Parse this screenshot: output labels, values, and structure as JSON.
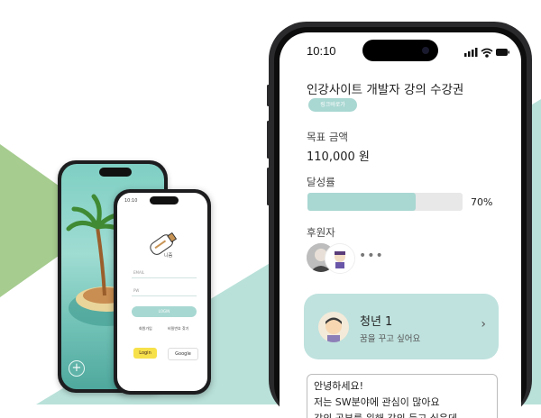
{
  "colors": {
    "accent": "#a9d7d2",
    "card": "#bfe2de",
    "bg_green": "#a6cc8f",
    "bg_teal": "#b9e1d9"
  },
  "detail_screen": {
    "status_time": "10:10",
    "title": "인강사이트 개발자 강의 수강권",
    "chip_label": "링크바로가",
    "goal_label": "목표 금액",
    "goal_amount": "110,000 원",
    "progress_label": "달성률",
    "progress_value": 0.7,
    "progress_text": "70%",
    "supporters_label": "후원자",
    "more_icon": "more-dots-icon",
    "supporter_card": {
      "name": "청년 1",
      "subtitle": "꿈을 꾸고 싶어요",
      "chevron_icon": "chevron-right-icon"
    },
    "message_lines": [
      "안녕하세요!",
      "저는 SW분야에 관심이 많아요",
      "강의 공부를 위해 강의 듣고 싶은데"
    ]
  },
  "login_screen": {
    "status_time": "10:10",
    "logo_caption": "니즘",
    "email_placeholder": "EMAIL",
    "pw_placeholder": "PW",
    "login_button": "LOGIN",
    "signup_link": "회원가입",
    "find_pw_link": "비밀번호 찾기",
    "kakao_label": "Login",
    "google_label": "Google"
  },
  "island_screen": {
    "add_button": "+"
  }
}
